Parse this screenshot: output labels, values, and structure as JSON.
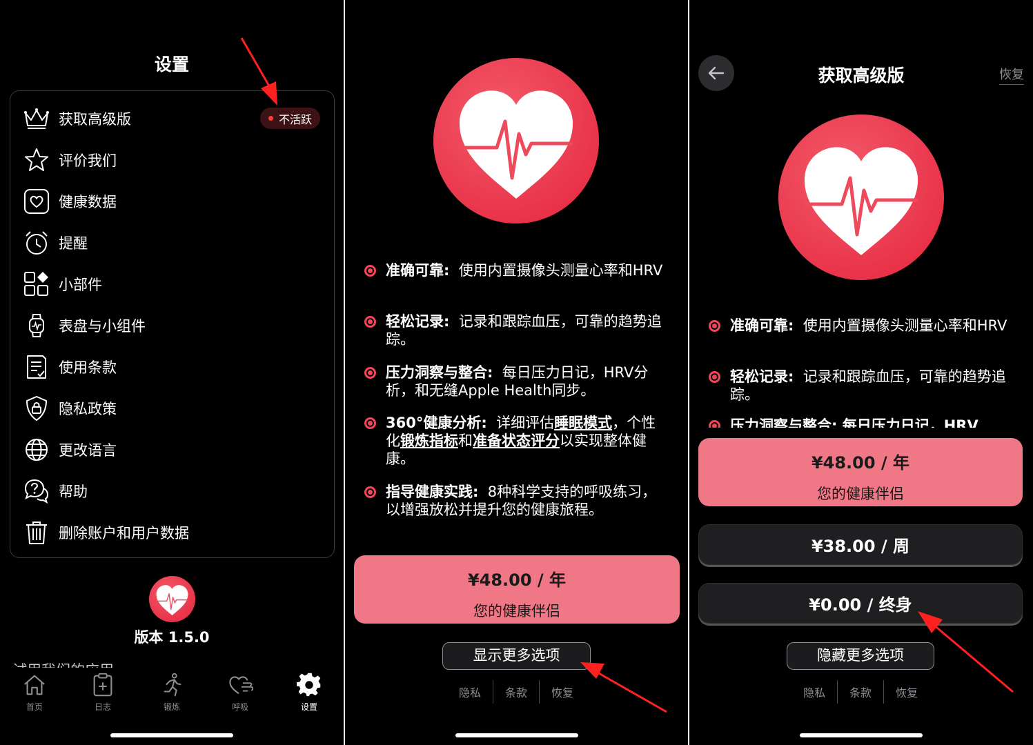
{
  "settings": {
    "title": "设置",
    "menu": [
      {
        "label": "获取高级版",
        "icon": "crown-icon"
      },
      {
        "label": "评价我们",
        "icon": "star-icon"
      },
      {
        "label": "健康数据",
        "icon": "health-data-icon"
      },
      {
        "label": "提醒",
        "icon": "alarm-clock-icon"
      },
      {
        "label": "小部件",
        "icon": "widgets-icon"
      },
      {
        "label": "表盘与小组件",
        "icon": "watch-icon"
      },
      {
        "label": "使用条款",
        "icon": "document-icon"
      },
      {
        "label": "隐私政策",
        "icon": "shield-lock-icon"
      },
      {
        "label": "更改语言",
        "icon": "globe-icon"
      },
      {
        "label": "帮助",
        "icon": "help-bubble-icon"
      },
      {
        "label": "删除账户和用户数据",
        "icon": "trash-icon"
      }
    ],
    "badge": "不活跃",
    "version": "版本 1.5.0",
    "clipped_text": "试用我们的应用",
    "tabs": [
      {
        "label": "首页",
        "icon": "home-icon"
      },
      {
        "label": "日志",
        "icon": "log-icon"
      },
      {
        "label": "锻炼",
        "icon": "running-icon"
      },
      {
        "label": "呼吸",
        "icon": "breath-heart-icon"
      },
      {
        "label": "设置",
        "icon": "gear-icon"
      }
    ]
  },
  "paywall": {
    "features": [
      {
        "title": "准确可靠:",
        "text": "使用内置摄像头测量心率和HRV"
      },
      {
        "title": "轻松记录:",
        "text": "记录和跟踪血压，可靠的趋势追踪。"
      },
      {
        "title": "压力洞察与整合:",
        "text": "每日压力日记，HRV分析，和无缝Apple Health同步。"
      },
      {
        "title": "360°健康分析:",
        "text_a": "详细评估",
        "link_a": "睡眠模式",
        "text_b": "，个性化",
        "link_b": "锻炼指标",
        "text_c": "和",
        "link_c": "准备状态评分",
        "text_d": "以实现整体健康。"
      },
      {
        "title": "指导健康实践:",
        "text": "8种科学支持的呼吸练习，以增强放松并提升您的健康旅程。"
      }
    ],
    "plan_yearly": {
      "price": "¥48.00 / 年",
      "subtitle": "您的健康伴侣"
    },
    "plan_weekly": {
      "price": "¥38.00 / 周"
    },
    "plan_lifetime": {
      "price": "¥0.00 / 终身"
    },
    "show_more": "显示更多选项",
    "hide_more": "隐藏更多选项",
    "links": [
      "隐私",
      "条款",
      "恢复"
    ],
    "clipped_feature": "压力洞察与整合:  每日压力日记，HRV"
  },
  "premium": {
    "title": "获取高级版",
    "restore": "恢复"
  },
  "colors": {
    "accent": "#f1465a",
    "plan_highlight": "#ef7786",
    "badge_bg": "#3d1214",
    "arrow": "#ff2020"
  }
}
